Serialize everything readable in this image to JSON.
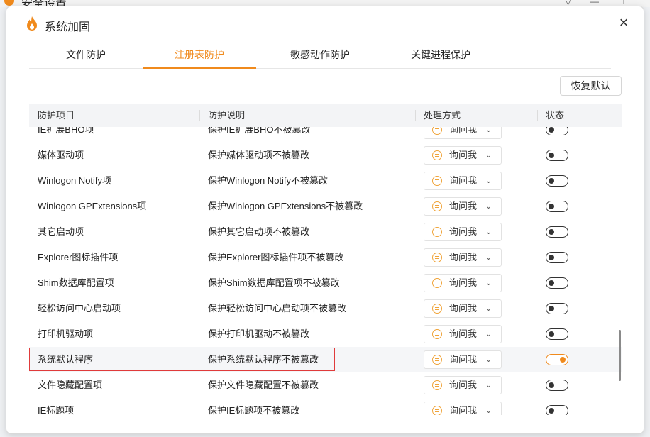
{
  "background_window": {
    "title": "安全设置"
  },
  "dialog": {
    "title": "系统加固",
    "close_glyph": "×",
    "brand_color": "#f08a1c",
    "logo_icon": "flame-icon"
  },
  "tabs": [
    {
      "label": "文件防护",
      "active": false
    },
    {
      "label": "注册表防护",
      "active": true
    },
    {
      "label": "敏感动作防护",
      "active": false
    },
    {
      "label": "关键进程保护",
      "active": false
    }
  ],
  "restore_button": "恢复默认",
  "table": {
    "headers": [
      "防护项目",
      "防护说明",
      "处理方式",
      "状态"
    ],
    "rows": [
      {
        "name": "IE扩展BHO项",
        "desc": "保护IE扩展BHO不被篡改",
        "action": "询问我",
        "on": false
      },
      {
        "name": "媒体驱动项",
        "desc": "保护媒体驱动项不被篡改",
        "action": "询问我",
        "on": false
      },
      {
        "name": "Winlogon Notify项",
        "desc": "保护Winlogon Notify不被篡改",
        "action": "询问我",
        "on": false
      },
      {
        "name": "Winlogon GPExtensions项",
        "desc": "保护Winlogon GPExtensions不被篡改",
        "action": "询问我",
        "on": false
      },
      {
        "name": "其它启动项",
        "desc": "保护其它启动项不被篡改",
        "action": "询问我",
        "on": false
      },
      {
        "name": "Explorer图标插件项",
        "desc": "保护Explorer图标插件项不被篡改",
        "action": "询问我",
        "on": false
      },
      {
        "name": "Shim数据库配置项",
        "desc": "保护Shim数据库配置项不被篡改",
        "action": "询问我",
        "on": false
      },
      {
        "name": "轻松访问中心启动项",
        "desc": "保护轻松访问中心启动项不被篡改",
        "action": "询问我",
        "on": false
      },
      {
        "name": "打印机驱动项",
        "desc": "保护打印机驱动不被篡改",
        "action": "询问我",
        "on": false
      },
      {
        "name": "系统默认程序",
        "desc": "保护系统默认程序不被篡改",
        "action": "询问我",
        "on": true,
        "hover": true
      },
      {
        "name": "文件隐藏配置项",
        "desc": "保护文件隐藏配置不被篡改",
        "action": "询问我",
        "on": false
      },
      {
        "name": "IE标题项",
        "desc": "保护IE标题项不被篡改",
        "action": "询问我",
        "on": false
      }
    ]
  }
}
